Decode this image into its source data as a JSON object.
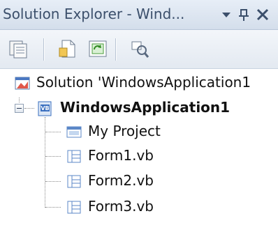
{
  "panel": {
    "title": "Solution Explorer - Wind...",
    "controls": {
      "dropdown_icon": "dropdown-arrow-icon",
      "pin_icon": "pin-icon",
      "close_icon": "close-icon"
    }
  },
  "toolbar": {
    "buttons": [
      {
        "icon": "properties-icon"
      },
      {
        "icon": "show-all-files-icon"
      },
      {
        "icon": "refresh-icon"
      },
      {
        "icon": "view-class-diagram-icon"
      }
    ]
  },
  "tree": {
    "solution": {
      "label": "Solution 'WindowsApplication1",
      "icon": "solution-icon"
    },
    "project": {
      "label": "WindowsApplication1",
      "icon": "vb-project-icon",
      "expanded": true
    },
    "children": [
      {
        "label": "My Project",
        "icon": "my-project-icon"
      },
      {
        "label": "Form1.vb",
        "icon": "form-file-icon"
      },
      {
        "label": "Form2.vb",
        "icon": "form-file-icon"
      },
      {
        "label": "Form3.vb",
        "icon": "form-file-icon"
      }
    ]
  },
  "colors": {
    "title_text": "#3b4f6b",
    "title_bar": "#d4deeb",
    "project_icon": "#3a6fbf",
    "form_icon": "#5b87c7"
  }
}
